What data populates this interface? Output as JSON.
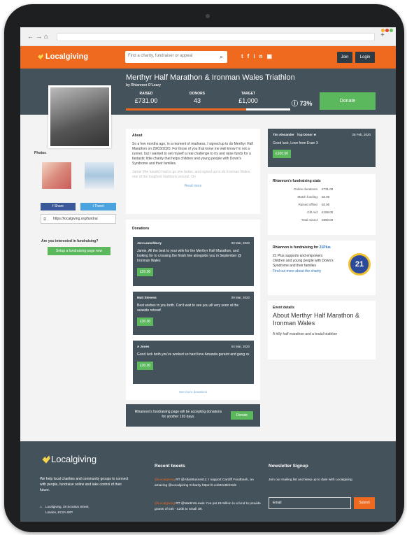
{
  "site": {
    "brand": "Localgiving",
    "search_placeholder": "Find a charity, fundraiser or appeal",
    "join": "Join",
    "login": "Login"
  },
  "social_icons": [
    "twitter-icon",
    "facebook-icon",
    "linkedin-icon",
    "youtube-icon"
  ],
  "colors": {
    "brand_orange": "#ef6a1f",
    "dark_slate": "#44525c",
    "action_green": "#5cb85c",
    "link_blue": "#6aa6d6"
  },
  "hero": {
    "title": "Merthyr Half Marathon & Ironman Wales Triathlon",
    "by": "by Rhiannon O'Leary",
    "raised_label": "RAISED",
    "raised": "£731.00",
    "donors_label": "DONORS",
    "donors": "43",
    "target_label": "TARGET",
    "target": "£1,000",
    "percent": "73%",
    "progress": 0.73,
    "donate": "Donate"
  },
  "sidebar": {
    "photos_label": "Photos",
    "share_label": "Share",
    "tweet_label": "Tweet",
    "share_url": "https://localgiving.org/fundrai",
    "interested": "Are you interested in fundraising?",
    "setup": "Setup a fundraising page now"
  },
  "about": {
    "title": "About",
    "text": "So a few months ago, in a moment of madness, I signed up to do Merthyr Half Marathon on 29/03/2020. For those of you that know me well know I'm not a runner, but I wanted to set myself a real challenge to try and raise funds for a fantastic little charity that helps children and young people with Down's Syndrome and their families.",
    "faded": "Jamie (the lunatic) had to go one better, and signed up to do Ironman Wales; one of the toughest triathlons around. On",
    "read_more": "Read more"
  },
  "donations": {
    "title": "Donations",
    "items": [
      {
        "name": "Jon Launchbury",
        "date": "09 Mar, 2020",
        "message": "Jamie, All the best to your wife for the Merthyr Half Marathon, and looking for to crossing the finish line alongside you in September @ Ironman Wales",
        "amount": "£20.00"
      },
      {
        "name": "Matt Stevens",
        "date": "09 Mar, 2020",
        "message": "Best wishes to you both. Can't wait to see you all very soon at the seaside retreat!",
        "amount": "£30.00"
      },
      {
        "name": "A Jones",
        "date": "04 Mar, 2020",
        "message": "Good luck both you've worked so hard love Amanda geraint and gang xx",
        "amount": "£30.00"
      }
    ],
    "see_more": "See more donations"
  },
  "accepting": {
    "text": "Rhiannon's fundraising page will be accepting donations for another 193 days.",
    "button": "Donate"
  },
  "top_donor": {
    "name": "Tim Alexander",
    "badge": "Top Donor ★",
    "date": "28 Feb, 2020",
    "message": "Good luck, Love from Evan X",
    "amount": "£100.00"
  },
  "stats": {
    "title": "Rhiannon's fundraising stats",
    "rows": [
      {
        "label": "Online donations:",
        "value": "£731.00"
      },
      {
        "label": "Match funding:",
        "value": "£0.00"
      },
      {
        "label": "Raised offline:",
        "value": "£0.00"
      },
      {
        "label": "Gift Aid:",
        "value": "£159.00"
      },
      {
        "label": "Total raised:",
        "value": "£890.00"
      }
    ]
  },
  "charity": {
    "title_prefix": "Rhiannon is fundraising for ",
    "name": "21Plus",
    "desc": "21 Plus supports and empowers children and young people with Down's Syndrome and their families",
    "link": "Find out more about the charity",
    "logo_text": "21"
  },
  "event": {
    "label": "Event details",
    "title": "About Merthyr Half Marathon & Ironman Wales",
    "desc": "A hilly half marathon and a brutal triathlon"
  },
  "footer": {
    "brand": "Localgiving",
    "about": "We help local charities and community groups to connect with people, fundraise online and take control of their future.",
    "addr1": "Localgiving, 28 Scrutton Street,",
    "addr2": "London, EC2A 4RP",
    "tweets_title": "Recent tweets",
    "tweet1_handle": "@Localgiving",
    "tweet1_text": " RT @AllanBusnes11: I support Cardiff Foodbank, an amazing @Localgiving #charity https://t.co/M2o9khOds",
    "tweet2_handle": "@Localgiving",
    "tweet2_text": " RT @MartinSLewis: I've put £1million in a fund to provide grants of £5k - £20k to small UK",
    "newsletter_title": "Newsletter Signup",
    "newsletter_text": "Join our mailing list and keep up to date with Localgiving",
    "email_placeholder": "Email",
    "submit": "Submit"
  }
}
